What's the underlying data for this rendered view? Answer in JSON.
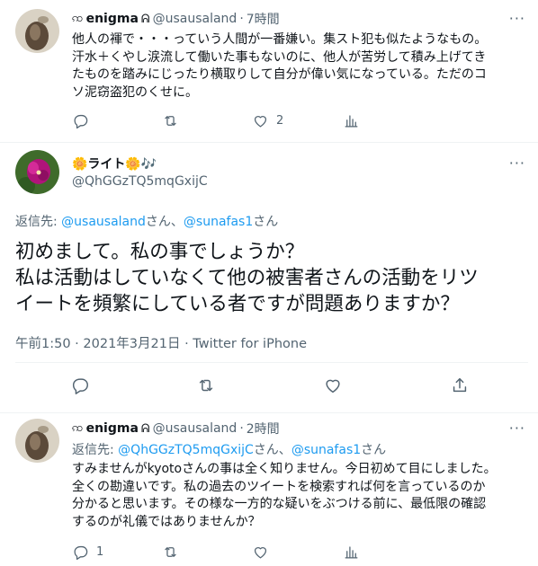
{
  "tweet1": {
    "name": "enigma",
    "name_prefix_glyph": "ꩡ",
    "name_suffix_glyph": "ᕱ",
    "handle": "@usausaland",
    "time": "7時間",
    "text_lines": [
      "他人の褌で・・・っていう人間が一番嫌い。集スト犯も似たようなもの。",
      "汗水＋くやし涙流して働いた事もないのに、他人が苦労して積み上げてき",
      "たものを踏みにじったり横取りして自分が偉い気になっている。ただのコ",
      "ソ泥窃盗犯のくせに。"
    ],
    "reply_count": "",
    "retweet_count": "",
    "like_count": "2"
  },
  "tweet2": {
    "name": "🌼ライト🌼🎶",
    "handle": "@QhGGzTQ5mqGxijC",
    "reply_label": "返信先: ",
    "reply_user1": "@usausaland",
    "reply_san1": "さん、",
    "reply_user2": "@sunafas1",
    "reply_san2": "さん",
    "text_lines": [
      "初めまして。私の事でしょうか？",
      "私は活動はしていなくて他の被害者さんの活動をリツ",
      "イートを頻繁にしている者ですが問題ありますか？"
    ],
    "timestamp": "午前1:50 · 2021年3月21日 · Twitter for iPhone"
  },
  "tweet3": {
    "name": "enigma",
    "name_prefix_glyph": "ꩡ",
    "name_suffix_glyph": "ᕱ",
    "handle": "@usausaland",
    "time": "2時間",
    "reply_label": "返信先: ",
    "reply_user1": "@QhGGzTQ5mqGxijC",
    "reply_san1": "さん、",
    "reply_user2": "@sunafas1",
    "reply_san2": "さん",
    "text_lines": [
      "すみませんがkyotoさんの事は全く知りません。今日初めて目にしました。",
      "全くの勘違いです。私の過去のツイートを検索すれば何を言っているのか",
      "分かると思います。その様な一方的な疑いをぶつける前に、最低限の確認",
      "するのが礼儀ではありませんか？"
    ],
    "reply_count": "1",
    "retweet_count": "",
    "like_count": ""
  },
  "separator_dot": "·",
  "more_label": "···",
  "colors": {
    "text": "#0f1419",
    "secondary": "#536471",
    "link": "#1d9bf0",
    "divider": "#eff3f4",
    "thread_line": "#cfd9de"
  },
  "icons": [
    "reply-icon",
    "retweet-icon",
    "like-icon",
    "analytics-icon",
    "share-icon",
    "more-icon"
  ]
}
